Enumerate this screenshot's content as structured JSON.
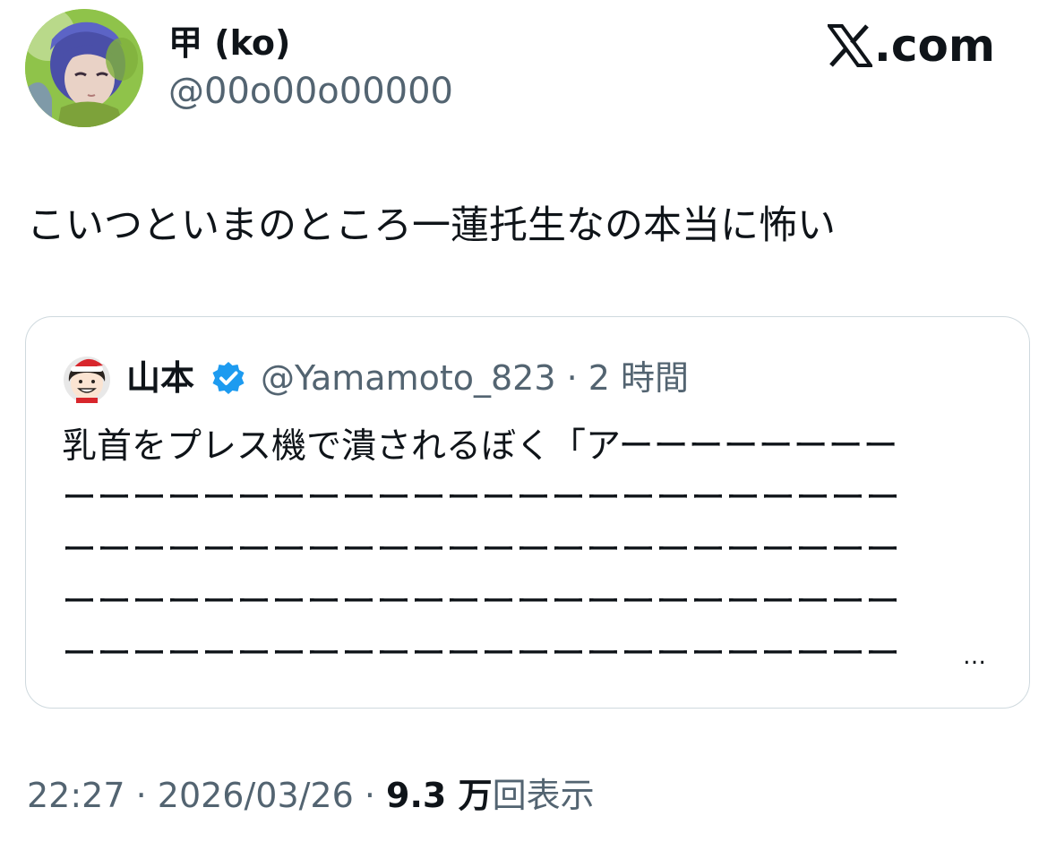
{
  "author": {
    "display_name": "甲 (ko)",
    "handle": "@00o00o00000"
  },
  "brand": {
    "label": ".com"
  },
  "tweet": {
    "text": "こいつといまのところ一蓮托生なの本当に怖い"
  },
  "quoted_tweet": {
    "display_name": "山本",
    "handle": "@Yamamoto_823",
    "separator": "·",
    "time_ago": "2 時間",
    "text_lines": [
      "乳首をプレス機で潰されるぼく「アーーーーーーーー",
      "ーーーーーーーーーーーーーーーーーーーーーーーー",
      "ーーーーーーーーーーーーーーーーーーーーーーーー",
      "ーーーーーーーーーーーーーーーーーーーーーーーー",
      "ーーーーーーーーーーーーーーーーーーーーーーーー"
    ],
    "truncation": "…",
    "verified": true
  },
  "footer": {
    "time": "22:27",
    "sep1": " · ",
    "date": "2026/03/26",
    "sep2": " · ",
    "views_count": "9.3 万",
    "views_label": "回表示"
  },
  "colors": {
    "text_primary": "#0f1419",
    "text_secondary": "#536471",
    "border": "#cfd9de",
    "verified_blue": "#1d9bf0"
  },
  "icons": {
    "author_avatar": "anime-character-avatar",
    "quote_avatar": "santa-hat-person-avatar",
    "verified": "verified-badge-icon",
    "brand": "x-logo-icon"
  }
}
